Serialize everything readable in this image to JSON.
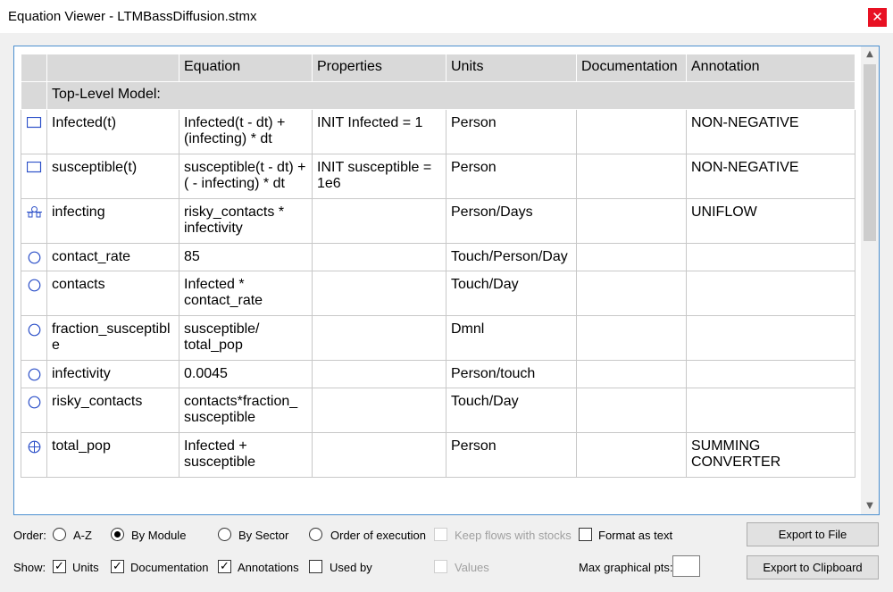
{
  "window": {
    "title": "Equation Viewer - LTMBassDiffusion.stmx",
    "close_glyph": "✕"
  },
  "table": {
    "headers": [
      "",
      "",
      "Equation",
      "Properties",
      "Units",
      "Documentation",
      "Annotation"
    ],
    "section_label": "Top-Level Model:",
    "rows": [
      {
        "icon": "stock-icon",
        "name": "Infected(t)",
        "equation": "Infected(t - dt) + (infecting) * dt",
        "properties": "INIT Infected = 1",
        "units": "Person",
        "documentation": "",
        "annotation": "NON-NEGATIVE"
      },
      {
        "icon": "stock-icon",
        "name": "susceptible(t)",
        "equation": "susceptible(t - dt) + ( - infecting) * dt",
        "properties": "INIT susceptible = 1e6",
        "units": "Person",
        "documentation": "",
        "annotation": "NON-NEGATIVE"
      },
      {
        "icon": "flow-icon",
        "name": "infecting",
        "equation": "risky_contacts * infectivity",
        "properties": "",
        "units": "Person/Days",
        "documentation": "",
        "annotation": "UNIFLOW"
      },
      {
        "icon": "converter-icon",
        "name": "contact_rate",
        "equation": "85",
        "properties": "",
        "units": "Touch/Person/Day",
        "documentation": "",
        "annotation": ""
      },
      {
        "icon": "converter-icon",
        "name": "contacts",
        "equation": "Infected * contact_rate",
        "properties": "",
        "units": "Touch/Day",
        "documentation": "",
        "annotation": ""
      },
      {
        "icon": "converter-icon",
        "name": "fraction_susceptible",
        "equation": "susceptible/ total_pop",
        "properties": "",
        "units": "Dmnl",
        "documentation": "",
        "annotation": ""
      },
      {
        "icon": "converter-icon",
        "name": "infectivity",
        "equation": "0.0045",
        "properties": "",
        "units": "Person/touch",
        "documentation": "",
        "annotation": ""
      },
      {
        "icon": "converter-icon",
        "name": "risky_contacts",
        "equation": "contacts*fraction_ susceptible",
        "properties": "",
        "units": "Touch/Day",
        "documentation": "",
        "annotation": ""
      },
      {
        "icon": "summing-converter-icon",
        "name": "total_pop",
        "equation": "Infected + susceptible",
        "properties": "",
        "units": "Person",
        "documentation": "",
        "annotation": "SUMMING CONVERTER"
      }
    ]
  },
  "controls": {
    "order_label": "Order:",
    "order_options": [
      "A-Z",
      "By Module",
      "By Sector",
      "Order of execution"
    ],
    "order_selected": "By Module",
    "keep_flows": "Keep flows with stocks",
    "format_text": "Format as text",
    "show_label": "Show:",
    "show_units": "Units",
    "show_documentation": "Documentation",
    "show_annotations": "Annotations",
    "show_used_by": "Used by",
    "show_values": "Values",
    "max_pts_label": "Max graphical pts:",
    "max_pts_value": "",
    "export_file": "Export to File",
    "export_clipboard": "Export to Clipboard",
    "check_glyph": "✓"
  },
  "colors": {
    "accent": "#4b8fd0",
    "close": "#e81123",
    "header": "#d9d9d9",
    "icon": "#2b4fc8"
  }
}
